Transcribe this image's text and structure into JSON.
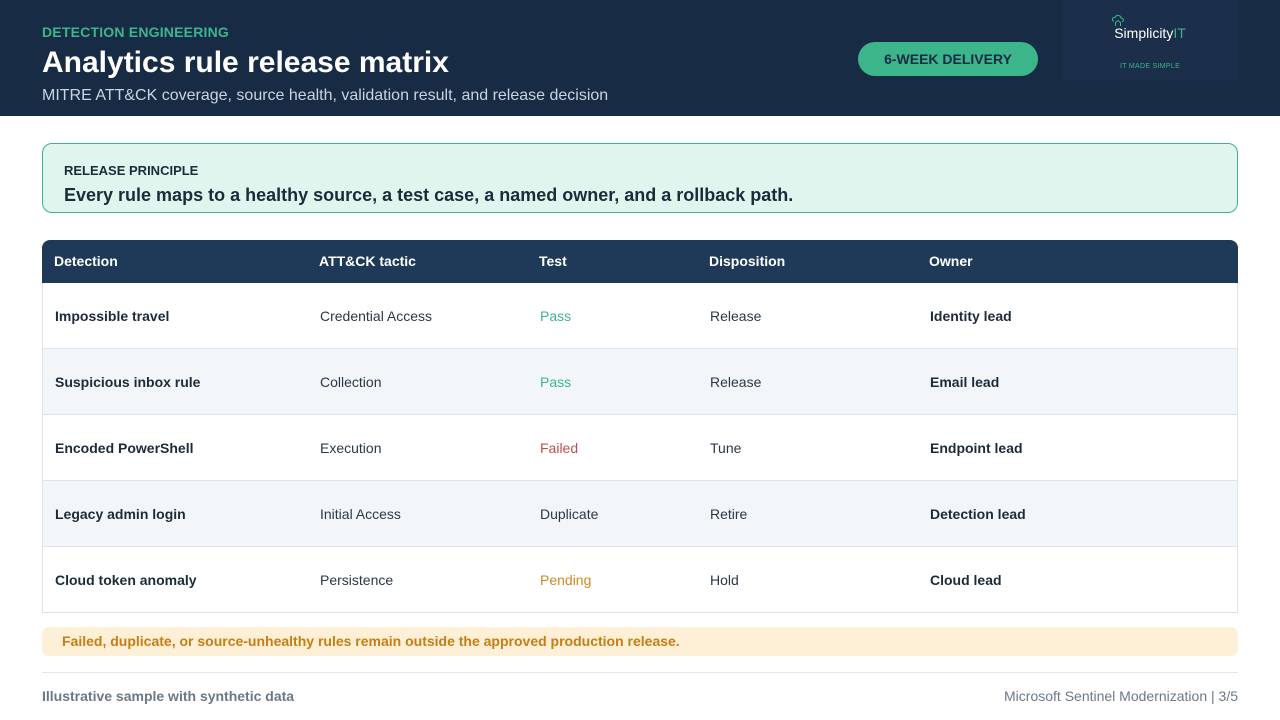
{
  "header": {
    "eyebrow": "DETECTION ENGINEERING",
    "title": "Analytics rule release matrix",
    "subtitle": "MITRE ATT&CK coverage, source health, validation result, and release decision",
    "badge": "6-WEEK DELIVERY",
    "logo": {
      "name_main": "Simplicity",
      "name_accent": "IT",
      "tagline": "IT MADE SIMPLE",
      "icon": "cloud-house-icon"
    }
  },
  "principle": {
    "label": "RELEASE PRINCIPLE",
    "text": "Every rule maps to a healthy source, a test case, a named owner, and a rollback path."
  },
  "table": {
    "headers": [
      "Detection",
      "ATT&CK tactic",
      "Test",
      "Disposition",
      "Owner"
    ],
    "rows": [
      {
        "detection": "Impossible travel",
        "tactic": "Credential Access",
        "test": "Pass",
        "disposition": "Release",
        "owner": "Identity lead"
      },
      {
        "detection": "Suspicious inbox rule",
        "tactic": "Collection",
        "test": "Pass",
        "disposition": "Release",
        "owner": "Email lead"
      },
      {
        "detection": "Encoded PowerShell",
        "tactic": "Execution",
        "test": "Failed",
        "disposition": "Tune",
        "owner": "Endpoint lead"
      },
      {
        "detection": "Legacy admin login",
        "tactic": "Initial Access",
        "test": "Duplicate",
        "disposition": "Retire",
        "owner": "Detection lead"
      },
      {
        "detection": "Cloud token anomaly",
        "tactic": "Persistence",
        "test": "Pending",
        "disposition": "Hold",
        "owner": "Cloud lead"
      }
    ]
  },
  "warning": "Failed, duplicate, or source-unhealthy rules remain outside the approved production release.",
  "footer": {
    "left": "Illustrative sample with synthetic data",
    "right": "Microsoft Sentinel Modernization | 3/5"
  },
  "colors": {
    "navy": "#172b45",
    "green": "#3db58b",
    "pass": "#3db58b",
    "failed": "#c0504d",
    "pending": "#d08a1e",
    "neutral": "#2a3847"
  }
}
